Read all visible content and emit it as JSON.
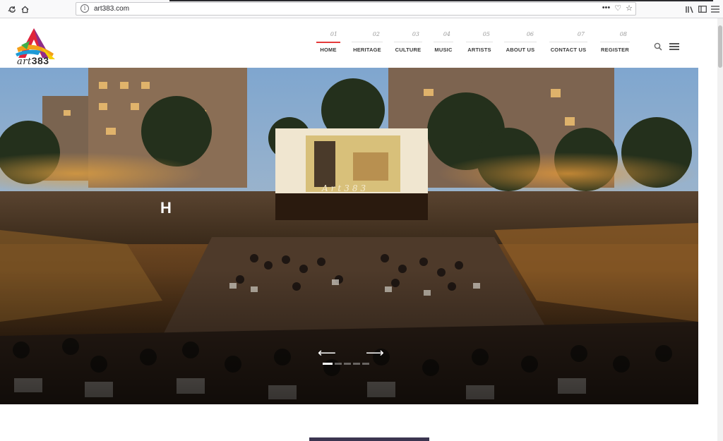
{
  "browser": {
    "url": "art383.com",
    "info_glyph": "i",
    "actions": [
      "•••",
      "♡",
      "☆"
    ],
    "right_icons": [
      "library-icon",
      "sidebar-icon",
      "menu-icon"
    ]
  },
  "site": {
    "logo_prefix": "art",
    "logo_number": "383",
    "nav": [
      {
        "num": "01",
        "label": "HOME",
        "active": true
      },
      {
        "num": "02",
        "label": "HERITAGE",
        "active": false
      },
      {
        "num": "03",
        "label": "CULTURE",
        "active": false
      },
      {
        "num": "04",
        "label": "MUSIC",
        "active": false
      },
      {
        "num": "05",
        "label": "ARTISTS",
        "active": false
      },
      {
        "num": "06",
        "label": "ABOUT US",
        "active": false
      },
      {
        "num": "07",
        "label": "CONTACT US",
        "active": false
      },
      {
        "num": "08",
        "label": "REGISTER",
        "active": false
      }
    ]
  },
  "hero": {
    "heading_letter": "H",
    "screen_caption": "Art383",
    "prev_arrow": "⟵",
    "next_arrow": "⟶",
    "slides_total": 5,
    "active_slide": 1
  },
  "colors": {
    "accent": "#e53a3a",
    "sky": "#5a7fa8",
    "night": "#1a120b"
  }
}
